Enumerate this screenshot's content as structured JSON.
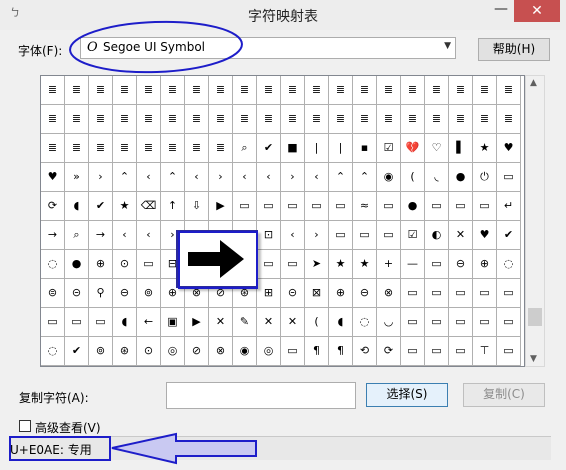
{
  "window": {
    "title": "字符映射表",
    "minimize_glyph": "—",
    "close_glyph": "✕",
    "app_icon": "charmap-icon"
  },
  "font_row": {
    "label": "字体(F):",
    "selected_font": "Segoe UI Symbol",
    "font_type_glyph": "O",
    "help_button": "帮助(H)"
  },
  "grid": {
    "rows": 10,
    "cols": 20,
    "cells": [
      [
        "≣",
        "≣",
        "≣",
        "≣",
        "≣",
        "≣",
        "≣",
        "≣",
        "≣",
        "≣",
        "≣",
        "≣",
        "≣",
        "≣",
        "≣",
        "≣",
        "≣",
        "≣",
        "≣",
        "≣"
      ],
      [
        "≣",
        "≣",
        "≣",
        "≣",
        "≣",
        "≣",
        "≣",
        "≣",
        "≣",
        "≣",
        "≣",
        "≣",
        "≣",
        "≣",
        "≣",
        "≣",
        "≣",
        "≣",
        "≣",
        "≣"
      ],
      [
        "≣",
        "≣",
        "≣",
        "≣",
        "≣",
        "≣",
        "≣",
        "≣",
        "⌕",
        "✔",
        "■",
        "|",
        "|",
        "▪",
        "☑",
        "💔",
        "♡",
        "▌",
        "★",
        "♥"
      ],
      [
        "♥",
        "»",
        "›",
        "⌃",
        "‹",
        "⌃",
        "‹",
        "›",
        "‹",
        "‹",
        "›",
        "‹",
        "⌃",
        "⌃",
        "◉",
        "(",
        "◟",
        "●",
        "⏻",
        "▭"
      ],
      [
        "⟳",
        "◖",
        "✔",
        "★",
        "⌫",
        "↑",
        "⇩",
        "▶",
        "▭",
        "▭",
        "▭",
        "▭",
        "▭",
        "≈",
        "▭",
        "●",
        "▭",
        "▭",
        "▭",
        "↵"
      ],
      [
        "→",
        "⌕",
        "→",
        "‹",
        "‹",
        "›",
        "⊞",
        "⊟",
        "⊠",
        "⊡",
        "‹",
        "›",
        "▭",
        "▭",
        "▭",
        "☑",
        "◐",
        "✕",
        "♥",
        "✔"
      ],
      [
        "◌",
        "●",
        "⊕",
        "⊙",
        "▭",
        "⊟",
        "▭",
        "▭",
        "▭",
        "▭",
        "▭",
        "➤",
        "★",
        "★",
        "+",
        "—",
        "▭",
        "⊖",
        "⊕",
        "◌"
      ],
      [
        "⊜",
        "⊝",
        "⚲",
        "⊖",
        "⊚",
        "⊕",
        "⊗",
        "⊘",
        "⊛",
        "⊞",
        "⊝",
        "⊠",
        "⊕",
        "⊖",
        "⊗",
        "▭",
        "▭",
        "▭",
        "▭",
        "▭"
      ],
      [
        "▭",
        "▭",
        "▭",
        "◖",
        "←",
        "▣",
        "▶",
        "✕",
        "✎",
        "✕",
        "✕",
        "(",
        "◖",
        "◌",
        "◡",
        "▭",
        "▭",
        "▭",
        "▭",
        "▭"
      ],
      [
        "◌",
        "✔",
        "⊚",
        "⊛",
        "⊙",
        "◎",
        "⊘",
        "⊗",
        "◉",
        "◎",
        "▭",
        "¶",
        "¶",
        "⟲",
        "⟳",
        "▭",
        "▭",
        "▭",
        "⊤",
        "▭"
      ]
    ],
    "magnified_char": "➔"
  },
  "copy_row": {
    "label": "复制字符(A):",
    "value": "",
    "select_button": "选择(S)",
    "copy_button": "复制(C)"
  },
  "advanced": {
    "label": "高级查看(V)",
    "checked": false
  },
  "status": {
    "text": "U+E0AE: 专用"
  },
  "annotations": {
    "color": "#1d1dc9"
  }
}
